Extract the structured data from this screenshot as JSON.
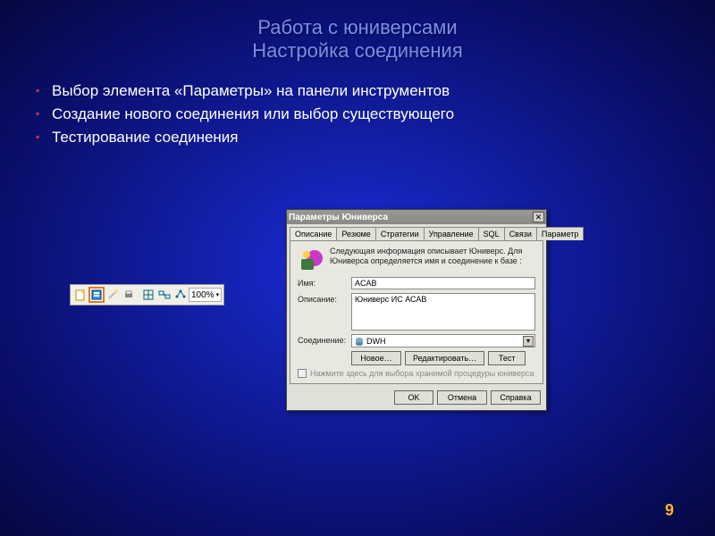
{
  "slide": {
    "title_line1": "Работа с юниверсами",
    "title_line2": "Настройка соединения",
    "bullets": [
      "Выбор элемента «Параметры» на панели инструментов",
      "Создание нового соединения или выбор существующего",
      "Тестирование соединения"
    ],
    "page_number": "9"
  },
  "toolbar": {
    "zoom": "100%"
  },
  "dialog": {
    "title": "Параметры Юниверса",
    "tabs": [
      "Описание",
      "Резюме",
      "Стратегии",
      "Управление",
      "SQL",
      "Связи",
      "Параметр"
    ],
    "active_tab": 0,
    "info_text": "Следующая информация описывает Юниверс. Для Юниверса определяется имя и соединение к базе :",
    "name_label": "Имя:",
    "name_value": "ACAB",
    "desc_label": "Описание:",
    "desc_value": "Юниверс ИС АСАВ",
    "conn_label": "Соединение:",
    "conn_value": "DWH",
    "btn_new": "Новое…",
    "btn_edit": "Редактировать…",
    "btn_test": "Тест",
    "chk_label": "Нажмите здесь для выбора хранимой процедуры юниверса",
    "btn_ok": "OK",
    "btn_cancel": "Отмена",
    "btn_help": "Справка"
  }
}
